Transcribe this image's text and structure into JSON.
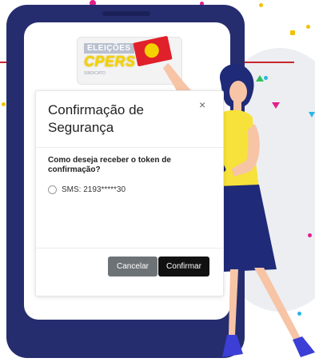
{
  "logo": {
    "top_text": "ELEIÇÕES",
    "main_text": "CPERS",
    "sub_text": "SINDICATO"
  },
  "modal": {
    "title": "Confirmação de Segurança",
    "close_symbol": "×",
    "question": "Como deseja receber o token de confirmação?",
    "options": [
      {
        "label": "SMS: 2193*****30",
        "selected": false
      }
    ],
    "cancel_label": "Cancelar",
    "confirm_label": "Confirmar"
  },
  "colors": {
    "phone": "#262d6e",
    "accent_red": "#c9252b",
    "cancel_button": "#6d7277",
    "confirm_button": "#111111",
    "woman_shirt": "#f6e23a",
    "woman_skirt": "#1f2a78"
  }
}
